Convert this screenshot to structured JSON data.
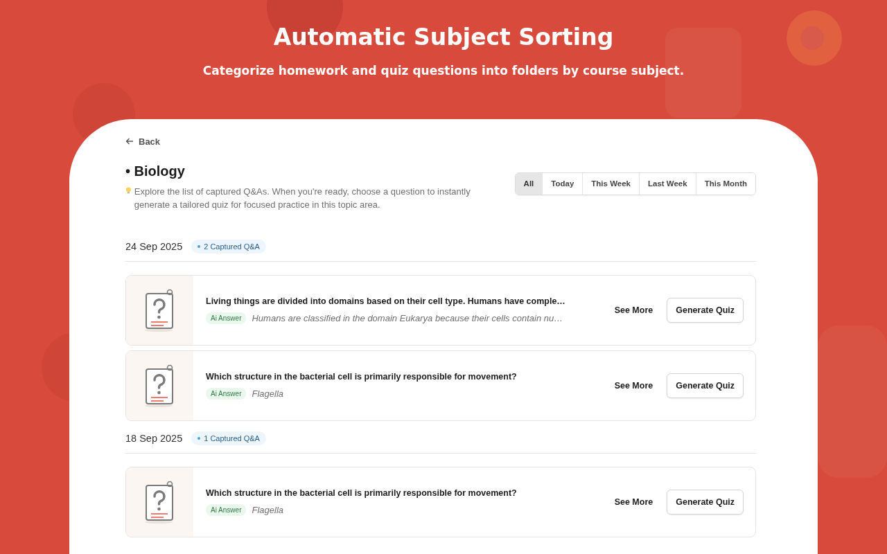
{
  "header": {
    "title": "Automatic Subject Sorting",
    "subtitle": "Categorize homework and quiz questions into folders by course subject."
  },
  "panel": {
    "back": "Back",
    "subject": "• Biology",
    "description": "Explore the list of captured Q&As. When you're ready, choose a question to instantly generate a tailored quiz for focused practice in this topic area.",
    "filters": [
      {
        "label": "All",
        "selected": true
      },
      {
        "label": "Today",
        "selected": false
      },
      {
        "label": "This Week",
        "selected": false
      },
      {
        "label": "Last Week",
        "selected": false
      },
      {
        "label": "This Month",
        "selected": false
      }
    ],
    "groups": [
      {
        "date": "24 Sep 2025",
        "count": "2 Captured Q&A",
        "items": [
          {
            "question": "Living things are divided into domains based on their cell type. Humans have comple…",
            "answer_label": "Ai Answer",
            "answer": "Humans are classified in the domain Eukarya because their cells contain nu…",
            "see_more": "See More",
            "action": "Generate Quiz"
          },
          {
            "question": "Which structure in the bacterial cell is primarily responsible for movement?",
            "answer_label": "Ai Answer",
            "answer": "Flagella",
            "see_more": "See More",
            "action": "Generate Quiz"
          }
        ]
      },
      {
        "date": "18 Sep 2025",
        "count": "1 Captured Q&A",
        "items": [
          {
            "question": "Which structure in the bacterial cell is primarily responsible for movement?",
            "answer_label": "Ai Answer",
            "answer": "Flagella",
            "see_more": "See More",
            "action": "Generate Quiz"
          }
        ]
      }
    ]
  }
}
